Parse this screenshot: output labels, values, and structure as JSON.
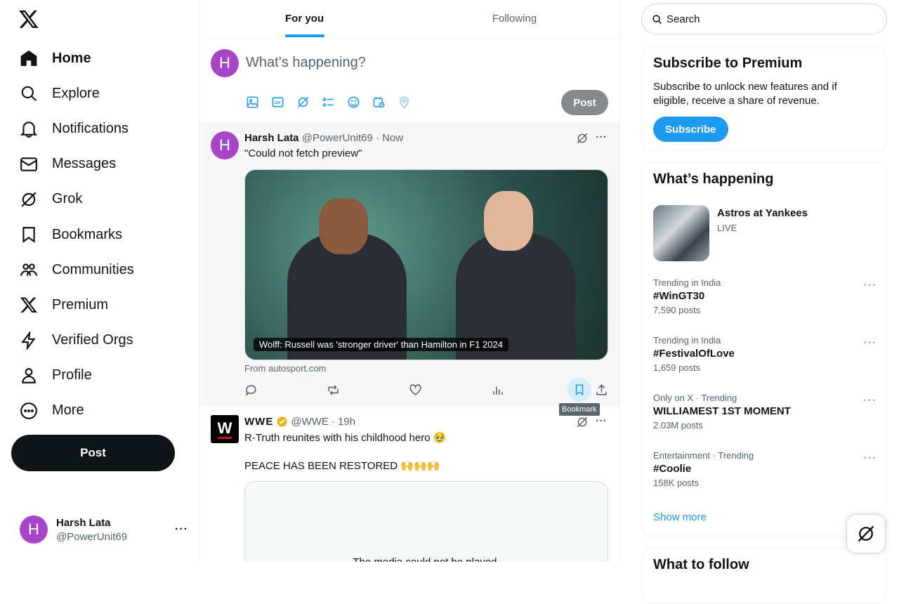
{
  "nav": {
    "items": [
      {
        "label": "Home",
        "icon": "home-icon"
      },
      {
        "label": "Explore",
        "icon": "search-icon"
      },
      {
        "label": "Notifications",
        "icon": "bell-icon"
      },
      {
        "label": "Messages",
        "icon": "mail-icon"
      },
      {
        "label": "Grok",
        "icon": "grok-icon"
      },
      {
        "label": "Bookmarks",
        "icon": "bookmark-icon"
      },
      {
        "label": "Communities",
        "icon": "communities-icon"
      },
      {
        "label": "Premium",
        "icon": "x-icon"
      },
      {
        "label": "Verified Orgs",
        "icon": "bolt-icon"
      },
      {
        "label": "Profile",
        "icon": "person-icon"
      },
      {
        "label": "More",
        "icon": "more-circle-icon"
      }
    ],
    "post_label": "Post"
  },
  "account": {
    "initial": "H",
    "name": "Harsh Lata",
    "handle": "@PowerUnit69"
  },
  "tabs": [
    "For you",
    "Following"
  ],
  "composer": {
    "placeholder": "What’s happening?",
    "post_label": "Post"
  },
  "tweets": [
    {
      "name": "Harsh Lata",
      "handle": "@PowerUnit69",
      "time": "· Now",
      "text": "\"Could not fetch preview\"",
      "card_caption": "Wolff: Russell was 'stronger driver' than Hamilton in F1 2024",
      "card_source": "From autosport.com",
      "tooltip": "Bookmark"
    },
    {
      "name": "WWE",
      "handle": "@WWE",
      "time": "· 19h",
      "text": "R-Truth reunites with his childhood hero 🥹",
      "text2": "PEACE HAS BEEN RESTORED 🙌🙌🙌",
      "media_msg": "The media could not be played."
    }
  ],
  "search": {
    "placeholder": "Search"
  },
  "premium": {
    "title": "Subscribe to Premium",
    "text": "Subscribe to unlock new features and if eligible, receive a share of revenue.",
    "button": "Subscribe"
  },
  "happening": {
    "title": "What’s happening",
    "live": {
      "title": "Astros at Yankees",
      "status": "LIVE"
    },
    "trends": [
      {
        "context": "Trending in India",
        "title": "#WinGT30",
        "posts": "7,590 posts"
      },
      {
        "context": "Trending in India",
        "title": "#FestivalOfLove",
        "posts": "1,659 posts"
      },
      {
        "context": "Only on X · Trending",
        "title": "WILLIAMEST 1ST MOMENT",
        "posts": "2.03M posts"
      },
      {
        "context": "Entertainment · Trending",
        "title": "#Coolie",
        "posts": "158K posts"
      }
    ],
    "show_more": "Show more"
  },
  "follow": {
    "title": "What to follow"
  },
  "colors": {
    "accent": "#1d9bf0",
    "avatar": "#a744c8"
  }
}
